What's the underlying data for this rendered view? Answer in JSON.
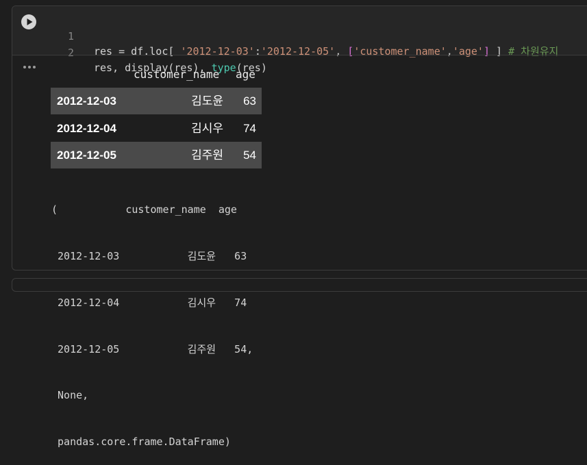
{
  "code": {
    "line_numbers": [
      "1",
      "2"
    ],
    "line1": {
      "seg1": "res = df.loc[ ",
      "seg2": "'2012-12-03'",
      "seg3": ":",
      "seg4": "'2012-12-05'",
      "seg5": ", ",
      "seg6": "[",
      "seg7": "'customer_name'",
      "seg8": ",",
      "seg9": "'age'",
      "seg10": "]",
      "seg11": " ] ",
      "comment": "# 차원유지"
    },
    "line2": {
      "seg1": "res, display(res), ",
      "fn": "type",
      "seg2": "(res)"
    }
  },
  "dataframe": {
    "columns": [
      "customer_name",
      "age"
    ],
    "rows": [
      {
        "index": "2012-12-03",
        "customer_name": "김도윤",
        "age": "63"
      },
      {
        "index": "2012-12-04",
        "customer_name": "김시우",
        "age": "74"
      },
      {
        "index": "2012-12-05",
        "customer_name": "김주원",
        "age": "54"
      }
    ]
  },
  "text_output": [
    "(           customer_name  age",
    " 2012-12-03           김도윤   63",
    " 2012-12-04           김시우   74",
    " 2012-12-05           김주원   54,",
    " None,",
    " pandas.core.frame.DataFrame)"
  ],
  "colors": {
    "background": "#1e1e1e",
    "code_background": "#262626",
    "string": "#ce9178",
    "comment": "#6a9955",
    "type_builtin": "#4ec9b0",
    "bracket": "#da70d6",
    "row_shade": "#4a4a4a"
  },
  "icons": {
    "run": "play-circle-icon",
    "output_menu": "more-horizontal-icon"
  }
}
